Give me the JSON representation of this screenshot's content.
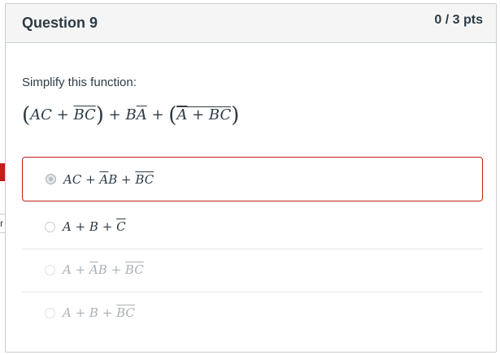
{
  "question": {
    "title": "Question 9",
    "points": "0 / 3 pts",
    "prompt": "Simplify this function:"
  },
  "answers": [
    {
      "text": "AC + ĀB + B̄C̄",
      "state": "selected-incorrect"
    },
    {
      "text": "A + B + C̄",
      "state": "correct"
    },
    {
      "text": "A + ĀB + B̄C̄",
      "state": "unselected"
    },
    {
      "text": "A + B + B̄C̄",
      "state": "unselected"
    }
  ],
  "flags": {
    "incorrect_flag_text": "",
    "correct_flag_text": "r"
  },
  "colors": {
    "incorrect": "#c2201b",
    "header_bg": "#f5f5f5",
    "text": "#2d3b45"
  }
}
